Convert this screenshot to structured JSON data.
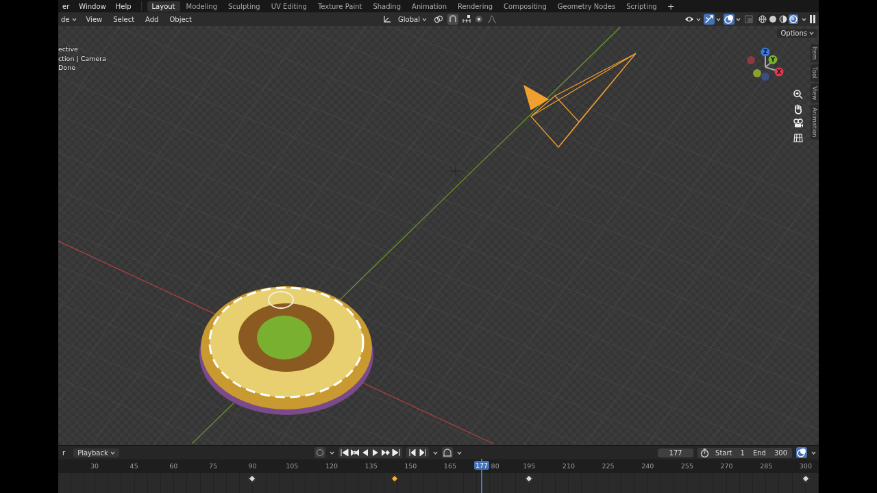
{
  "menu": [
    {
      "label": "er"
    },
    {
      "label": "Window"
    },
    {
      "label": "Help"
    }
  ],
  "workspaces": [
    {
      "label": "Layout",
      "selected": true
    },
    {
      "label": "Modeling",
      "selected": false
    },
    {
      "label": "Sculpting",
      "selected": false
    },
    {
      "label": "UV Editing",
      "selected": false
    },
    {
      "label": "Texture Paint",
      "selected": false
    },
    {
      "label": "Shading",
      "selected": false
    },
    {
      "label": "Animation",
      "selected": false
    },
    {
      "label": "Rendering",
      "selected": false
    },
    {
      "label": "Compositing",
      "selected": false
    },
    {
      "label": "Geometry Nodes",
      "selected": false
    },
    {
      "label": "Scripting",
      "selected": false
    }
  ],
  "add_workspace": "+",
  "header": {
    "mode": "de",
    "menus": [
      "View",
      "Select",
      "Add",
      "Object"
    ],
    "orientation": "Global",
    "toggles": [
      {
        "kind": "visibility",
        "on": false
      },
      {
        "kind": "gizmo",
        "on": true
      },
      {
        "kind": "overlay",
        "on": true
      },
      {
        "kind": "xray",
        "on": false
      }
    ],
    "shading": [
      {
        "kind": "wireframe",
        "selected": false
      },
      {
        "kind": "solid",
        "selected": false
      },
      {
        "kind": "material",
        "selected": false
      },
      {
        "kind": "rendered",
        "selected": true
      }
    ]
  },
  "viewport": {
    "info": [
      "ective",
      "ction | Camera",
      "Done"
    ],
    "options": "Options",
    "axes": [
      "Z",
      "Y",
      "X"
    ],
    "sidebar_tabs": [
      "Item",
      "Tool",
      "View",
      "Animation"
    ]
  },
  "timeline": {
    "editor": "r",
    "menu": "Playback",
    "current_frame": "177",
    "start_label": "Start",
    "start": "1",
    "end_label": "End",
    "end": "300",
    "playhead": "177",
    "ruler": [
      {
        "label": "30",
        "clipped": false
      },
      {
        "label": "45",
        "clipped": false
      },
      {
        "label": "60",
        "clipped": false
      },
      {
        "label": "75",
        "clipped": false
      },
      {
        "label": "90",
        "clipped": false
      },
      {
        "label": "105",
        "clipped": false
      },
      {
        "label": "120",
        "clipped": false
      },
      {
        "label": "135",
        "clipped": false
      },
      {
        "label": "150",
        "clipped": false
      },
      {
        "label": "165",
        "clipped": false
      },
      {
        "label": "80",
        "clipped": true
      },
      {
        "label": "195",
        "clipped": false
      },
      {
        "label": "210",
        "clipped": false
      },
      {
        "label": "225",
        "clipped": false
      },
      {
        "label": "240",
        "clipped": false
      },
      {
        "label": "255",
        "clipped": false
      },
      {
        "label": "270",
        "clipped": false
      },
      {
        "label": "285",
        "clipped": false
      },
      {
        "label": "300",
        "clipped": false
      }
    ],
    "keyframes": [
      {
        "selected": false
      },
      {
        "selected": true
      },
      {
        "selected": false
      },
      {
        "selected": false
      }
    ]
  }
}
